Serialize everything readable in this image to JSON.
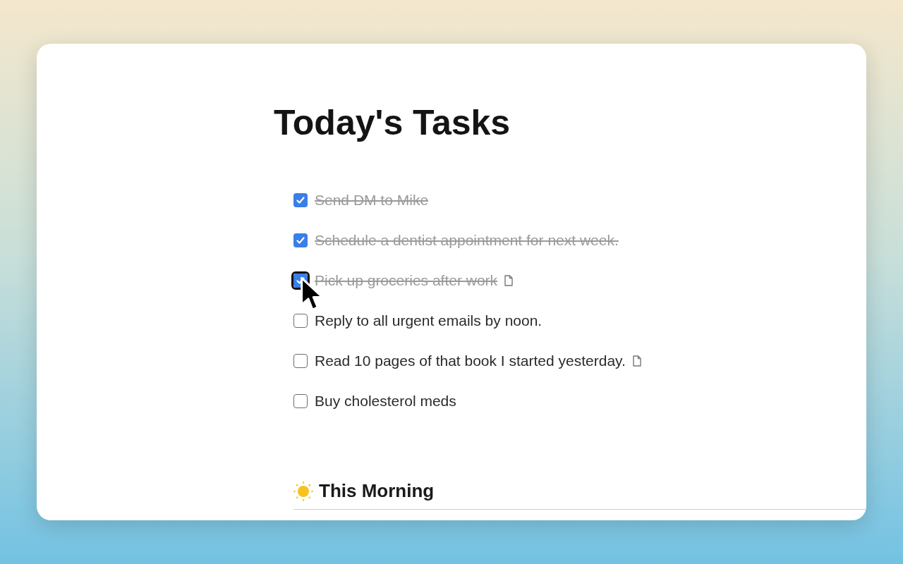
{
  "title": "Today's Tasks",
  "tasks": [
    {
      "text": "Send DM to Mike",
      "checked": true,
      "focused": false,
      "has_page": false
    },
    {
      "text": "Schedule a dentist appointment for next week.",
      "checked": true,
      "focused": false,
      "has_page": false
    },
    {
      "text": "Pick up groceries after work",
      "checked": true,
      "focused": true,
      "has_page": true
    },
    {
      "text": "Reply to all urgent emails by noon.",
      "checked": false,
      "focused": false,
      "has_page": false
    },
    {
      "text": "Read 10 pages of that book I started yesterday.",
      "checked": false,
      "focused": false,
      "has_page": true
    },
    {
      "text": "Buy cholesterol meds",
      "checked": false,
      "focused": false,
      "has_page": false
    }
  ],
  "section": {
    "heading": "This Morning"
  }
}
